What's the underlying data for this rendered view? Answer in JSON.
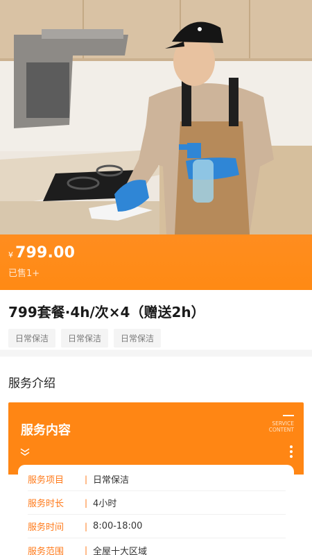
{
  "hero": {
    "alt_icon": "cleaner-photo"
  },
  "price": {
    "symbol": "¥",
    "value": "799.00",
    "sold": "已售1+"
  },
  "product": {
    "title": "799套餐·4h/次×4（赠送2h）",
    "tags": [
      "日常保洁",
      "日常保洁",
      "日常保洁"
    ]
  },
  "intro": {
    "title": "服务介绍",
    "card_heading": "服务内容",
    "card_en_line1": "SERVICE",
    "card_en_line2": "CONTENT",
    "rows": [
      {
        "key": "服务项目",
        "sep": "|",
        "value": "日常保洁"
      },
      {
        "key": "服务时长",
        "sep": "|",
        "value": "4小时"
      },
      {
        "key": "服务时间",
        "sep": "|",
        "value": "8:00-18:00"
      },
      {
        "key": "服务范围",
        "sep": "|",
        "value": "全屋十大区域"
      }
    ]
  },
  "colors": {
    "accent": "#ff8614",
    "tag_bg": "#f4f4f4"
  }
}
